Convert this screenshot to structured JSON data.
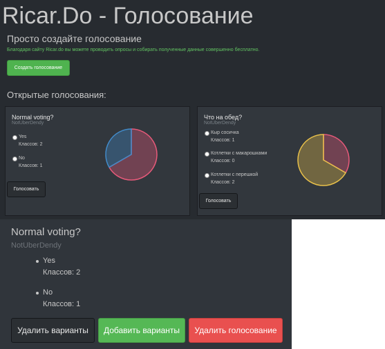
{
  "header": {
    "site_title": "Ricar.Do - Голосование",
    "subtitle": "Просто создайте голосование",
    "description": "Благодаря сайту Ricar.do вы можете проводить опросы и собирать полученные данные совершенно бесплатно.",
    "create_button": "Создать голосование"
  },
  "open_polls_title": "Открытые голосования:",
  "colors": {
    "background": "#272b30",
    "card": "#32373d",
    "success": "#4fb34f",
    "danger": "#e9504f",
    "pie_blue": "#428bca",
    "pie_red": "#e85a7a",
    "pie_yellow": "#e8c04a"
  },
  "polls": [
    {
      "title": "Normal voting?",
      "author": "NotUberDendy",
      "vote_button": "Голосовать",
      "options": [
        {
          "label": "Yes",
          "count_text": "Классов: 2",
          "count": 2
        },
        {
          "label": "No",
          "count_text": "Классов: 1",
          "count": 1
        }
      ],
      "pie_colors": [
        "#e85a7a",
        "#428bca"
      ]
    },
    {
      "title": "Что на обед?",
      "author": "NotUberDendy",
      "vote_button": "Голосовать",
      "options": [
        {
          "label": "Кыр сосичка",
          "count_text": "Классов: 1",
          "count": 1
        },
        {
          "label": "Котлетки с макарошками",
          "count_text": "Классов: 0",
          "count": 0
        },
        {
          "label": "Котлетки с перешкой",
          "count_text": "Классов: 2",
          "count": 2
        }
      ],
      "pie_colors": [
        "#e85a7a",
        "#7a8288",
        "#e8c04a"
      ]
    }
  ],
  "detail": {
    "title": "Normal voting?",
    "author": "NotUberDendy",
    "options": [
      {
        "label": "Yes",
        "count_text": "Классов: 2"
      },
      {
        "label": "No",
        "count_text": "Классов: 1"
      }
    ],
    "delete_options_button": "Удалить варианты",
    "add_options_button": "Добавить варианты",
    "delete_poll_button": "Удалить голосование"
  }
}
